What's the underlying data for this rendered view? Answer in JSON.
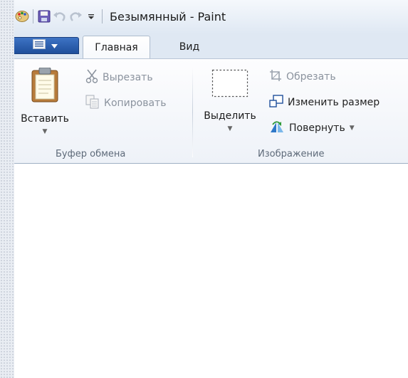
{
  "window": {
    "title": "Безымянный - Paint"
  },
  "tabs": {
    "home": "Главная",
    "view": "Вид"
  },
  "ribbon": {
    "clipboard": {
      "paste": "Вставить",
      "cut": "Вырезать",
      "copy": "Копировать",
      "group_label": "Буфер обмена"
    },
    "image": {
      "select": "Выделить",
      "crop": "Обрезать",
      "resize": "Изменить размер",
      "rotate": "Повернуть",
      "group_label": "Изображение"
    }
  },
  "icons": {
    "qat": [
      "paint-palette-icon",
      "save-icon",
      "undo-icon",
      "redo-icon",
      "customize-qat-icon"
    ],
    "file_menu": "menu-icon"
  },
  "colors": {
    "file_button": "#2a5db0",
    "ribbon_bg": "#f5f7fb",
    "canvas": "#ffffff"
  }
}
